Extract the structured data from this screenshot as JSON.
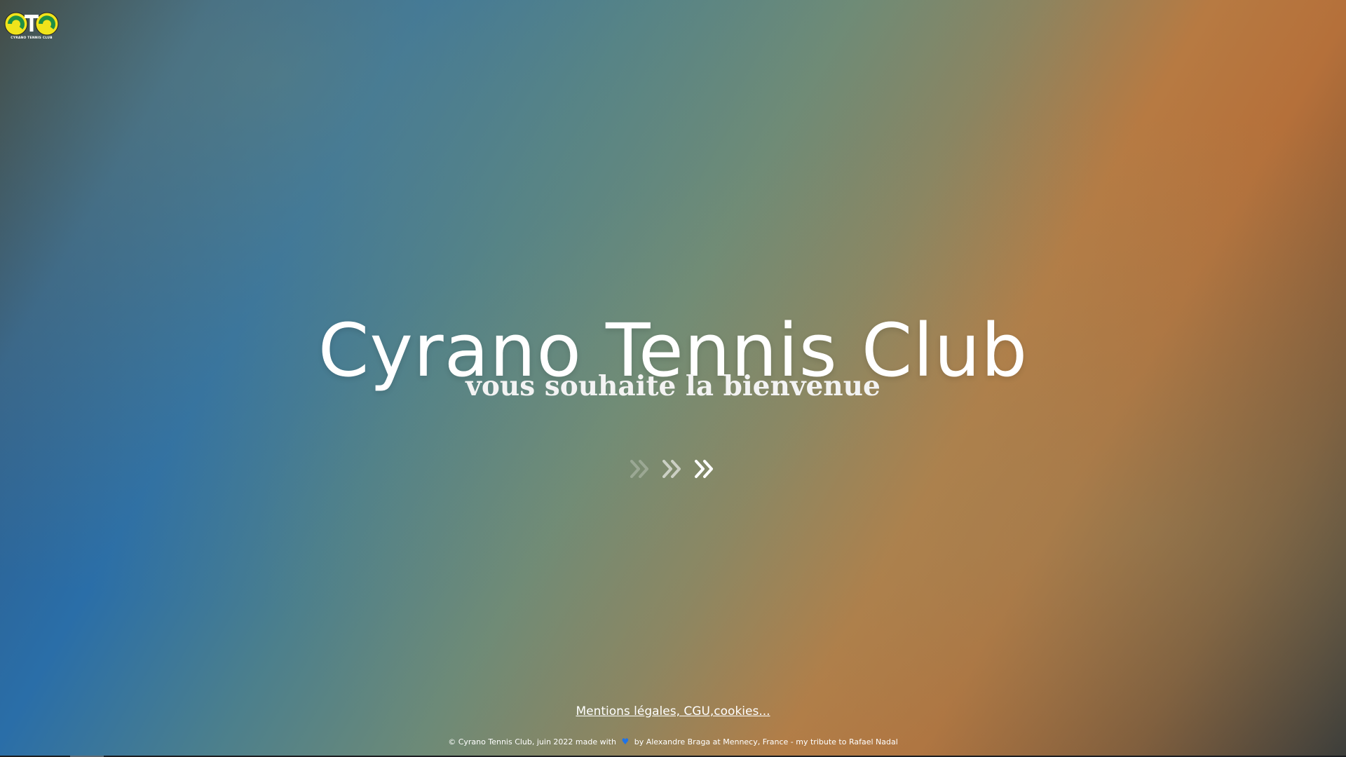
{
  "logo": {
    "initials": "CTC",
    "caption": "CYRANO TENNIS CLUB"
  },
  "hero": {
    "title": "Cyrano Tennis Club",
    "subtitle": "vous souhaite la bienvenue"
  },
  "nav": {
    "arrow_icon": "chevron-double-right-icon"
  },
  "footer": {
    "legal_link": "Mentions légales, CGU,cookies...",
    "copyright_before": "© Cyrano Tennis Club, juin 2022 made with",
    "heart": "♥",
    "copyright_after": "by Alexandre Braga at Mennecy, France - my tribute to Rafael Nadal"
  },
  "colors": {
    "logo_yellow": "#f0e31b",
    "logo_green": "#1f8f45",
    "heart_blue": "#1e73e8"
  }
}
